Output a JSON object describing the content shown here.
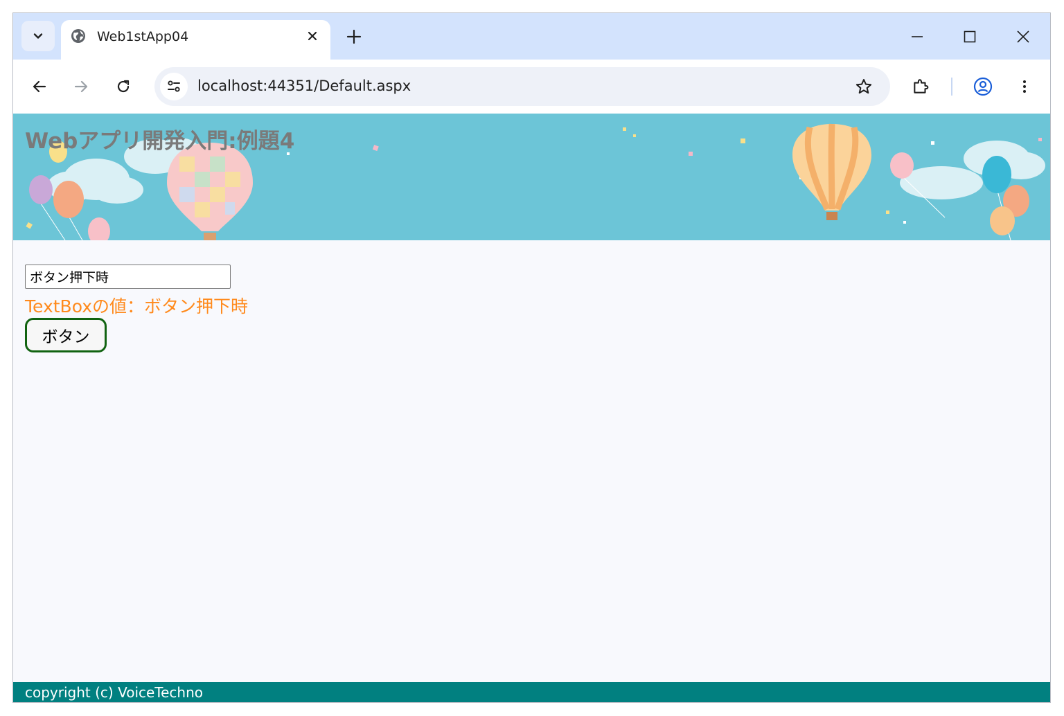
{
  "browser": {
    "tab": {
      "title": "Web1stApp04",
      "favicon": "globe-icon"
    },
    "address_bar": {
      "url": "localhost:44351/Default.aspx"
    },
    "icons": {
      "tab_search": "chevron-down-icon",
      "tab_close": "close-icon",
      "new_tab": "plus-icon",
      "minimize": "minimize-icon",
      "maximize": "maximize-icon",
      "close_window": "close-icon",
      "back": "arrow-left-icon",
      "forward": "arrow-right-icon",
      "reload": "reload-icon",
      "site_info": "tune-icon",
      "bookmark": "star-icon",
      "extensions": "puzzle-icon",
      "profile": "profile-icon",
      "menu": "more-vert-icon"
    },
    "colors": {
      "tabstrip_bg": "#d3e3fd",
      "omnibox_bg": "#eef1f8"
    }
  },
  "page": {
    "header": {
      "title": "Webアプリ開発入門:例題4"
    },
    "form": {
      "textbox_value": "ボタン押下時",
      "result_text": "TextBoxの値：ボタン押下時",
      "button_label": "ボタン"
    },
    "footer": {
      "copyright": "copyright (c) VoiceTechno"
    },
    "colors": {
      "banner_bg": "#6cc5d7",
      "result_text": "#ff8a1c",
      "button_border": "#116311",
      "footer_bg": "#018080"
    }
  }
}
